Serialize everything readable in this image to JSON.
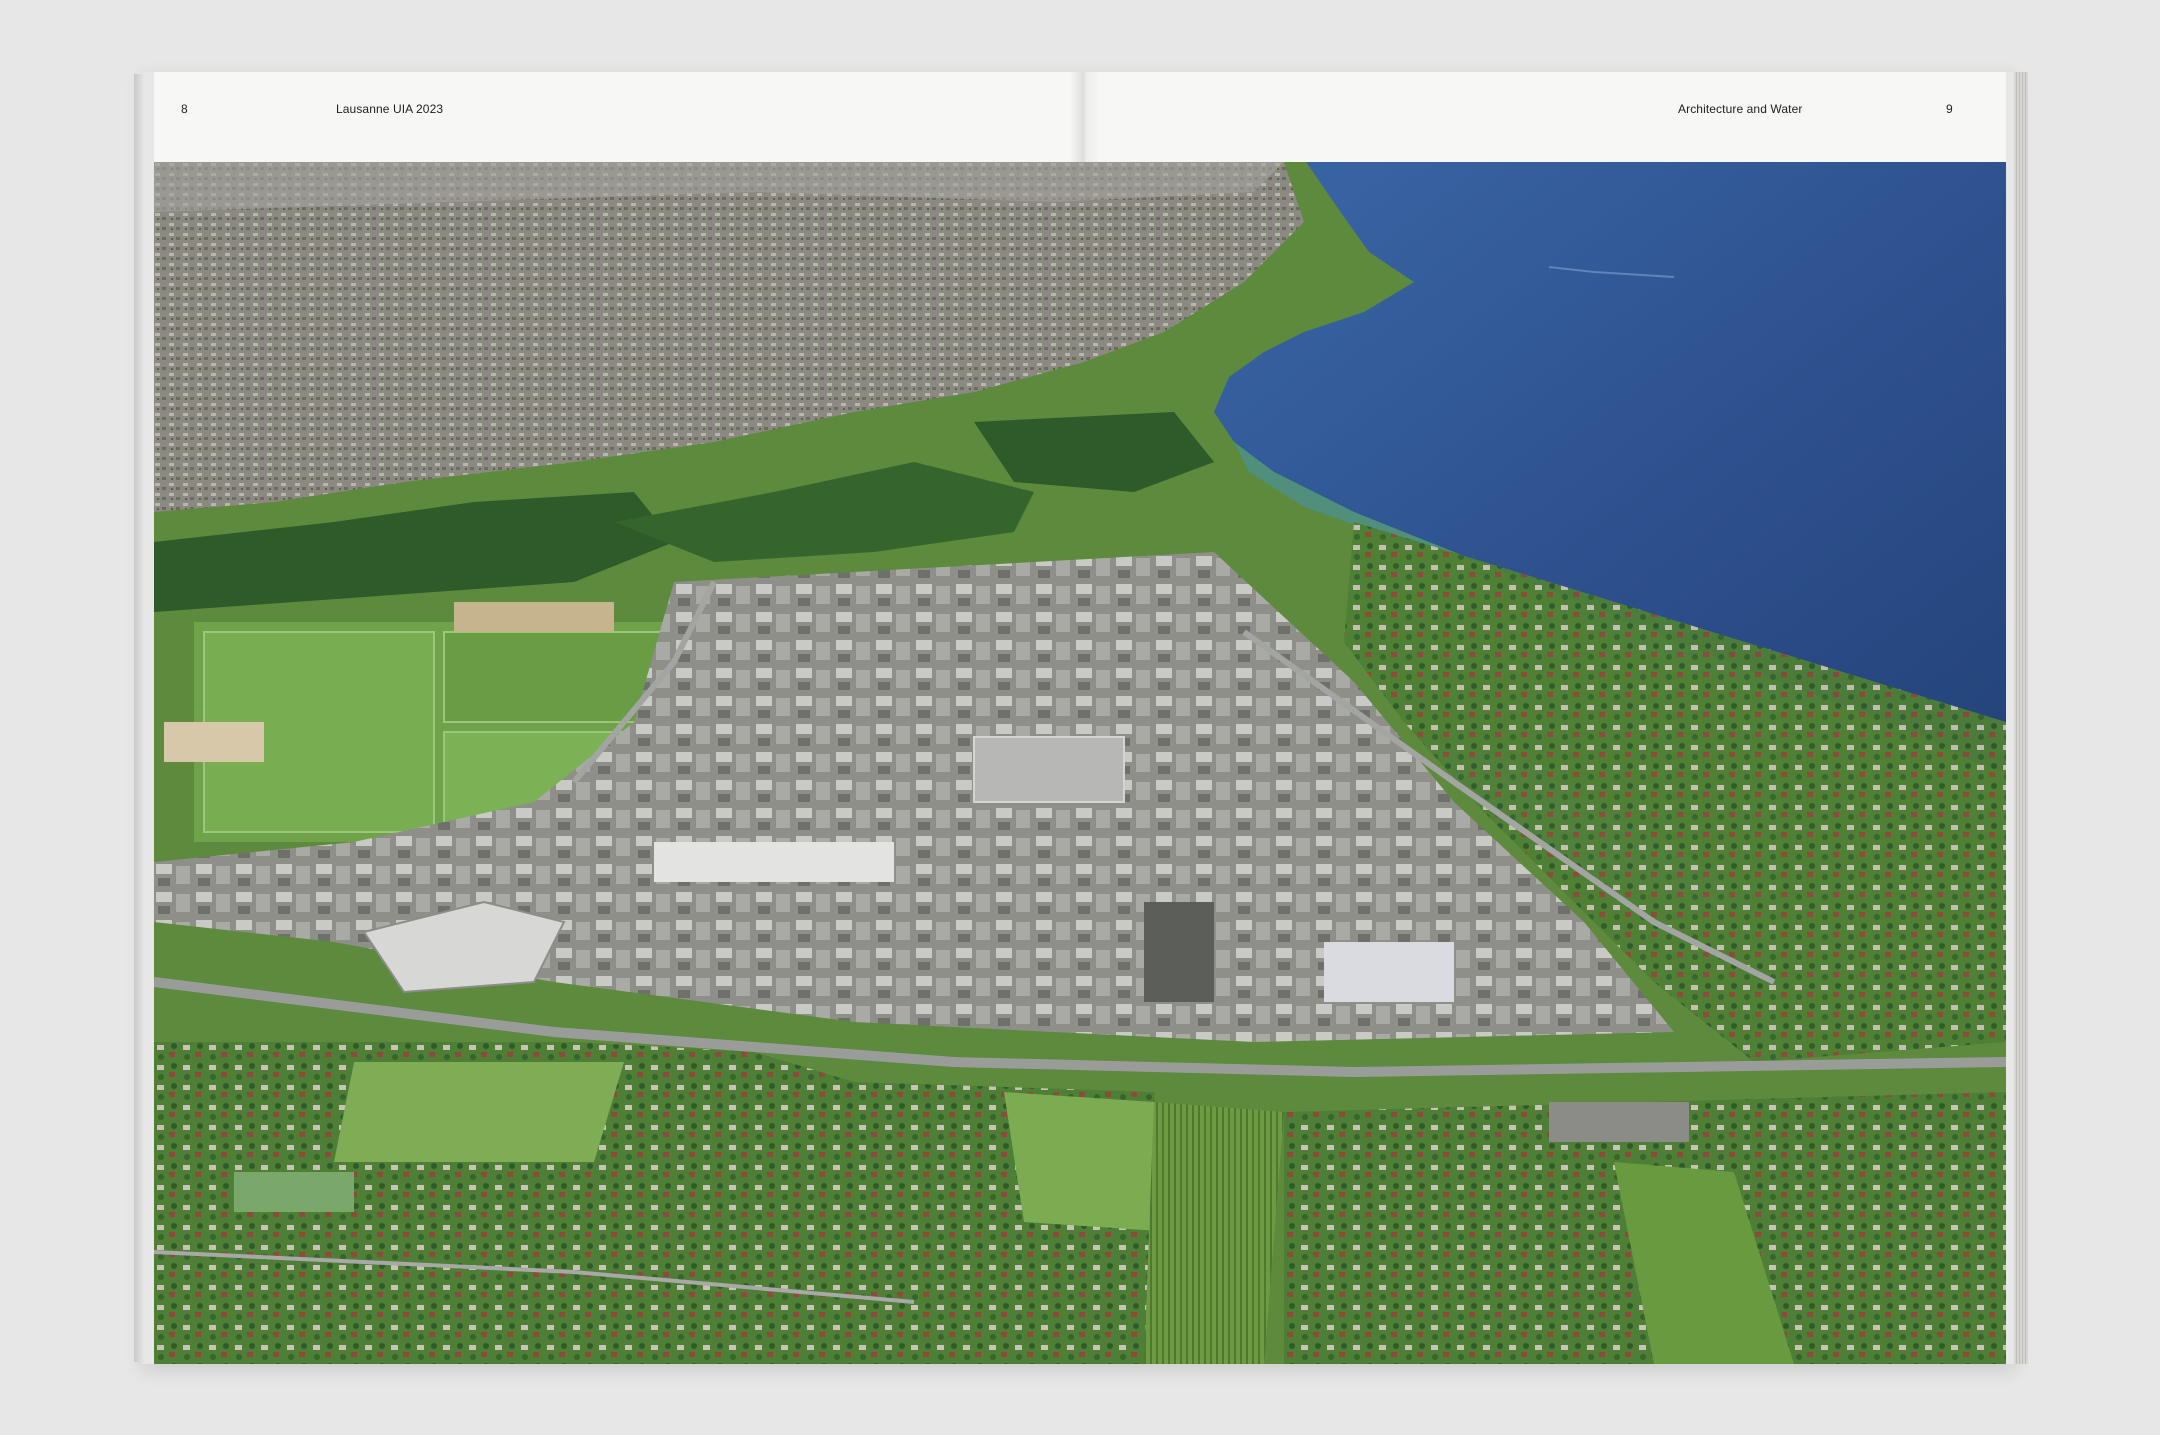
{
  "spread": {
    "left_page": {
      "page_number": "8",
      "running_title": "Lausanne UIA 2023"
    },
    "right_page": {
      "running_title": "Architecture and Water",
      "page_number": "9"
    }
  },
  "photo": {
    "subject": "aerial-photo",
    "colors": {
      "lake": "#2d4f8c",
      "lake_light": "#3d6aa8",
      "shore": "#4f8f8c",
      "city": "#8e8a86",
      "green": "#5c8a3c",
      "forest": "#2f5a2a",
      "field": "#7aa84e"
    }
  }
}
